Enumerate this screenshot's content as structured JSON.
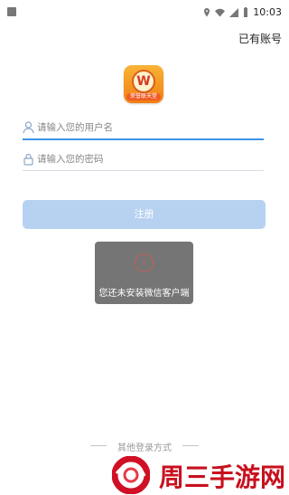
{
  "status_bar": {
    "time": "10:03",
    "left_icon": "square",
    "location_icon": "location-icon",
    "wifi_icon": "wifi-icon",
    "signal_icon": "signal-icon",
    "battery_icon": "battery-icon"
  },
  "header": {
    "account_link": "已有账号"
  },
  "app": {
    "logo_letter": "W",
    "logo_text": "荣誉联天堂"
  },
  "form": {
    "username_placeholder": "请输入您的用户名",
    "password_placeholder": "请输入您的密码",
    "register_button": "注册"
  },
  "toast": {
    "message": "您还未安装微信客户端",
    "icon": "warning-icon"
  },
  "footer": {
    "other_login": "其他登录方式"
  },
  "watermark": {
    "text": "周三手游网"
  },
  "colors": {
    "accent": "#3c95e8",
    "button": "#b7d2f1",
    "toast_background": "#757575",
    "watermark": "#c8101e"
  }
}
